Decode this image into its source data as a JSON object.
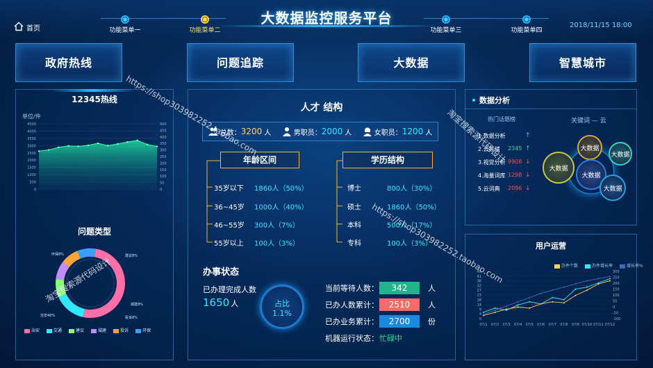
{
  "header": {
    "title": "大数据监控服务平台",
    "home_label": "首页",
    "menu": [
      "功能菜单一",
      "功能菜单二",
      "功能菜单三",
      "功能菜单四"
    ],
    "active_menu": 1,
    "datetime": "2018/11/15 18:00"
  },
  "nav_buttons": [
    "政府热线",
    "问题追踪",
    "大数据",
    "智慧城市"
  ],
  "hotline": {
    "title": "12345热线",
    "unit": "单位/件",
    "y_left": [
      "4500",
      "4000",
      "3500",
      "3000",
      "2500",
      "2000",
      "1500",
      "1000",
      "500",
      "0"
    ],
    "y_right": [
      "500",
      "450",
      "400",
      "350",
      "300",
      "250",
      "200",
      "150",
      "100",
      "50",
      "0"
    ]
  },
  "problem_type": {
    "title": "问题类型",
    "legend": [
      "治安",
      "交通",
      "建议",
      "城建",
      "投诉",
      "环保"
    ],
    "slice_labels": [
      "环保8%",
      "建议8%",
      "城建8%",
      "投诉8%",
      "治安48%"
    ]
  },
  "talent": {
    "title": "人才 结构",
    "stats": [
      {
        "label": "总数：",
        "value": "3200",
        "unit": "人"
      },
      {
        "label": "男职员：",
        "value": "2000",
        "unit": "人"
      },
      {
        "label": "女职员：",
        "value": "1200",
        "unit": "人"
      }
    ],
    "age_title": "年龄区间",
    "age_rows": [
      {
        "label": "35岁以下",
        "value": "1860人（50%）"
      },
      {
        "label": "36~45岁",
        "value": "1000人（40%）"
      },
      {
        "label": "46~55岁",
        "value": "300人（7%）"
      },
      {
        "label": "55岁以上",
        "value": "100人（3%）"
      }
    ],
    "edu_title": "学历结构",
    "edu_rows": [
      {
        "label": "博士",
        "value": "800人（30%）"
      },
      {
        "label": "硕士",
        "value": "1860人（50%）"
      },
      {
        "label": "本科",
        "value": "500人（17%）"
      },
      {
        "label": "专科",
        "value": "100人（3%）"
      }
    ]
  },
  "office": {
    "title": "办事状态",
    "done_label": "已办理完成人数",
    "done_value": "1650",
    "done_unit": "人",
    "ratio_label": "占比",
    "ratio_value": "1.1%",
    "waiting_label": "当前等待人数：",
    "waiting_value": "342",
    "waiting_unit": "人",
    "handled_label": "已办人数累计：",
    "handled_value": "2510",
    "handled_unit": "人",
    "business_label": "已办业务累计：",
    "business_value": "2700",
    "business_unit": "份",
    "machine_label": "机器运行状态：",
    "machine_value": "忙碌中"
  },
  "data_analysis": {
    "title": "数据分析",
    "hot_title": "热门话题榜",
    "hot_items": [
      {
        "name": "1.数据分析",
        "value": "",
        "dir": "up"
      },
      {
        "name": "2.云存储",
        "value": "2345",
        "dir": "up"
      },
      {
        "name": "3.视觉分析",
        "value": "9908",
        "dir": "down"
      },
      {
        "name": "4.海量词库",
        "value": "1298",
        "dir": "down"
      },
      {
        "name": "5.云词典",
        "value": "2096",
        "dir": "down"
      }
    ],
    "keyword_title": "关键词 — 云",
    "bubbles": [
      "大数据",
      "大数据",
      "大数据",
      "大数据",
      "大数据"
    ]
  },
  "user_ops": {
    "title": "用户运营",
    "legend": [
      "办件个数",
      "办件增长率",
      "增长率%"
    ],
    "x_labels": [
      "07/1",
      "07/2",
      "07/3",
      "07/4",
      "07/5",
      "07/6",
      "07/7",
      "07/8",
      "07/9",
      "07/10",
      "07/11",
      "07/12"
    ],
    "y_left": [
      "45",
      "41",
      "36",
      "32",
      "27",
      "23",
      "18",
      "14",
      "9",
      "4",
      "0"
    ],
    "y_right": [
      "300",
      "250",
      "200",
      "150",
      "100",
      "50",
      "0",
      "-50",
      "-100"
    ]
  },
  "watermarks": [
    "https://shop303982252.taobao.com",
    "淘宝搜索源代码设计"
  ],
  "colors": {
    "accent": "#2bb5ff",
    "active": "#ffd44a",
    "green": "#1fb489",
    "red": "#ff5b5b",
    "blue": "#1a8ae0"
  },
  "chart_data": [
    {
      "type": "area",
      "title": "12345热线",
      "ylabel": "单位/件",
      "ylim": [
        0,
        4500
      ],
      "values": [
        2620,
        2700,
        2880,
        2980,
        2950,
        3020,
        3160,
        3000,
        3120,
        3250,
        3360,
        3080,
        2940
      ],
      "grid": true
    },
    {
      "type": "pie",
      "title": "问题类型",
      "categories": [
        "治安",
        "交通",
        "建议",
        "城建",
        "投诉",
        "环保"
      ],
      "values": [
        48,
        14,
        8,
        8,
        8,
        8
      ]
    },
    {
      "type": "line",
      "title": "用户运营",
      "categories": [
        "07/1",
        "07/2",
        "07/3",
        "07/4",
        "07/5",
        "07/6",
        "07/7",
        "07/8",
        "07/9",
        "07/10",
        "07/11",
        "07/12"
      ],
      "ylim": [
        0,
        45
      ],
      "series": [
        {
          "name": "办件个数",
          "values": [
            3,
            6,
            9,
            11,
            10,
            14,
            16,
            15,
            22,
            27,
            33,
            36
          ]
        },
        {
          "name": "办件增长率",
          "values": [
            6,
            10,
            8,
            13,
            16,
            14,
            20,
            18,
            28,
            30,
            34,
            38
          ]
        },
        {
          "name": "增长率%",
          "values": [
            4,
            8,
            12,
            16,
            20,
            24,
            27,
            30,
            33,
            36,
            38,
            40
          ]
        }
      ]
    }
  ]
}
